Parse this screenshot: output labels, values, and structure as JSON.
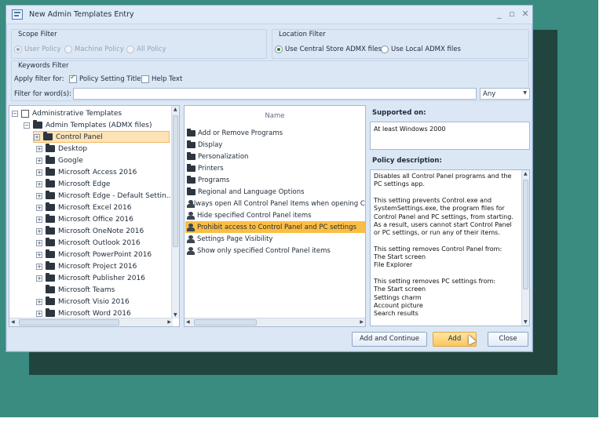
{
  "window": {
    "title": "New Admin Templates Entry"
  },
  "scope_filter": {
    "label": "Scope Filter",
    "options": [
      "User Policy",
      "Machine Policy",
      "All Policy"
    ],
    "selected": "User Policy"
  },
  "location_filter": {
    "label": "Location Filter",
    "options": [
      "Use Central Store ADMX files",
      "Use Local ADMX files"
    ],
    "selected": "Use Central Store ADMX files"
  },
  "keywords_filter": {
    "label": "Keywords Filter",
    "apply_label": "Apply  filter for:",
    "policy_setting_title": "Policy Setting Title",
    "help_text": "Help Text",
    "filter_label": "Filter for word(s):",
    "filter_value": "",
    "match_value": "Any"
  },
  "tree": {
    "root": "Administrative Templates",
    "admx": "Admin Templates (ADMX files)",
    "items": [
      "Control Panel",
      "Desktop",
      "Google",
      "Microsoft Access 2016",
      "Microsoft Edge",
      "Microsoft Edge - Default Settin...",
      "Microsoft Excel 2016",
      "Microsoft Office 2016",
      "Microsoft OneNote 2016",
      "Microsoft Outlook 2016",
      "Microsoft PowerPoint 2016",
      "Microsoft Project 2016",
      "Microsoft Publisher 2016",
      "Microsoft Teams",
      "Microsoft Visio 2016",
      "Microsoft Word 2016"
    ],
    "selected": "Control Panel"
  },
  "list": {
    "header": "Name",
    "items": [
      "Add or Remove Programs",
      "Display",
      "Personalization",
      "Printers",
      "Programs",
      "Regional and Language Options",
      "Always open All Control Panel Items when opening Control Panel",
      "Hide specified Control Panel items",
      "Prohibit access to Control Panel and PC settings",
      "Settings Page Visibility",
      "Show only specified Control Panel items"
    ],
    "selected": "Prohibit access to Control Panel and PC settings"
  },
  "details": {
    "supported_label": "Supported on:",
    "supported_value": "At least Windows 2000",
    "description_label": "Policy description:",
    "description_lines": [
      "Disables all Control Panel programs and the",
      "PC settings app.",
      "",
      "This setting prevents Control.exe and",
      "SystemSettings.exe, the program files for",
      "Control Panel and PC settings, from starting.",
      "As a result, users cannot start Control Panel",
      "or PC settings, or run any of their items.",
      "",
      "This setting removes Control Panel from:",
      "The Start screen",
      "File Explorer",
      "",
      "This setting removes PC settings from:",
      "The Start screen",
      "Settings charm",
      "Account picture",
      "Search results"
    ]
  },
  "buttons": {
    "add_continue": "Add and Continue",
    "add": "Add",
    "close": "Close"
  }
}
